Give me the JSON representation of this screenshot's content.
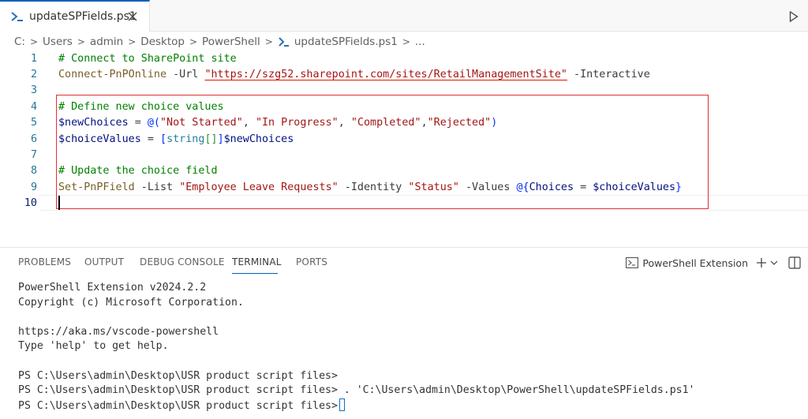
{
  "tab": {
    "filename": "updateSPFields.ps1",
    "close_glyph": "✕"
  },
  "breadcrumb": [
    "C:",
    "Users",
    "admin",
    "Desktop",
    "PowerShell",
    "updateSPFields.ps1",
    "..."
  ],
  "editor": {
    "lines": [
      {
        "n": "1",
        "tokens": [
          [
            "cmt",
            "# Connect to SharePoint site"
          ]
        ]
      },
      {
        "n": "2",
        "tokens": [
          [
            "cmd",
            "Connect-PnPOnline"
          ],
          [
            "param",
            " -Url "
          ],
          [
            "str url-underline",
            "\"https://szg52.sharepoint.com/sites/RetailManagementSite\""
          ],
          [
            "param",
            " -Interactive"
          ]
        ]
      },
      {
        "n": "3",
        "tokens": []
      },
      {
        "n": "4",
        "tokens": [
          [
            "cmt",
            "# Define new choice values"
          ]
        ]
      },
      {
        "n": "5",
        "tokens": [
          [
            "var",
            "$newChoices"
          ],
          [
            "op",
            " = "
          ],
          [
            "brk",
            "@("
          ],
          [
            "str",
            "\"Not Started\""
          ],
          [
            "op",
            ", "
          ],
          [
            "str",
            "\"In Progress\""
          ],
          [
            "op",
            ", "
          ],
          [
            "str",
            "\"Completed\""
          ],
          [
            "op",
            ","
          ],
          [
            "str",
            "\"Rejected\""
          ],
          [
            "brk",
            ")"
          ]
        ]
      },
      {
        "n": "6",
        "tokens": [
          [
            "var",
            "$choiceValues"
          ],
          [
            "op",
            " = "
          ],
          [
            "brk",
            "["
          ],
          [
            "typ",
            "string"
          ],
          [
            "brk2",
            "[]"
          ],
          [
            "brk",
            "]"
          ],
          [
            "var",
            "$newChoices"
          ]
        ]
      },
      {
        "n": "7",
        "tokens": []
      },
      {
        "n": "8",
        "tokens": [
          [
            "cmt",
            "# Update the choice field"
          ]
        ]
      },
      {
        "n": "9",
        "tokens": [
          [
            "cmd",
            "Set-PnPField"
          ],
          [
            "param",
            " -List "
          ],
          [
            "str",
            "\"Employee Leave Requests\""
          ],
          [
            "param",
            " -Identity "
          ],
          [
            "str",
            "\"Status\""
          ],
          [
            "param",
            " -Values "
          ],
          [
            "brk",
            "@{"
          ],
          [
            "var",
            "Choices"
          ],
          [
            "op",
            " = "
          ],
          [
            "var",
            "$choiceValues"
          ],
          [
            "brk",
            "}"
          ]
        ]
      },
      {
        "n": "10",
        "tokens": []
      }
    ],
    "active_line": "10"
  },
  "panel": {
    "tabs": [
      "PROBLEMS",
      "OUTPUT",
      "DEBUG CONSOLE",
      "TERMINAL",
      "PORTS"
    ],
    "active_tab": "TERMINAL",
    "terminal_name": "PowerShell Extension",
    "plus_glyph": "+",
    "chevron_glyph": "⌄"
  },
  "terminal": {
    "lines": [
      "PowerShell Extension v2024.2.2",
      "Copyright (c) Microsoft Corporation.",
      "",
      "https://aka.ms/vscode-powershell",
      "Type 'help' to get help.",
      "",
      "PS C:\\Users\\admin\\Desktop\\USR product script files>",
      "PS C:\\Users\\admin\\Desktop\\USR product script files> . 'C:\\Users\\admin\\Desktop\\PowerShell\\updateSPFields.ps1'",
      "PS C:\\Users\\admin\\Desktop\\USR product script files>"
    ]
  },
  "colors": {
    "accent": "#005fb8",
    "highlight_border": "#e03038",
    "comment": "#008000",
    "string": "#a31515",
    "variable": "#001080",
    "command": "#795e26"
  },
  "icons": {
    "tab_file": "powershell-icon",
    "close": "close-icon",
    "run": "run-icon",
    "terminal": "powershell-icon",
    "new_terminal": "plus-icon",
    "dropdown": "chevron-down-icon",
    "split": "split-terminal-icon"
  }
}
